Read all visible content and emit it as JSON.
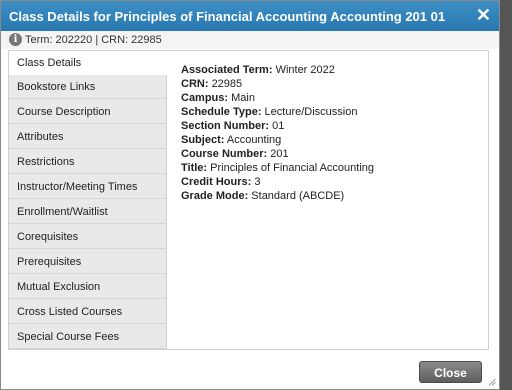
{
  "dialog": {
    "title": "Class Details for Principles of Financial Accounting Accounting 201 01",
    "close_icon": "✕"
  },
  "termbar": {
    "info_icon": "i",
    "text": "Term: 202220 | CRN: 22985"
  },
  "sidebar": {
    "items": [
      {
        "label": "Class Details",
        "active": true
      },
      {
        "label": "Bookstore Links"
      },
      {
        "label": "Course Description"
      },
      {
        "label": "Attributes"
      },
      {
        "label": "Restrictions"
      },
      {
        "label": "Instructor/Meeting Times"
      },
      {
        "label": "Enrollment/Waitlist"
      },
      {
        "label": "Corequisites"
      },
      {
        "label": "Prerequisites"
      },
      {
        "label": "Mutual Exclusion"
      },
      {
        "label": "Cross Listed Courses"
      },
      {
        "label": "Special Course Fees"
      }
    ]
  },
  "details": [
    {
      "label": "Associated Term:",
      "value": "Winter 2022"
    },
    {
      "label": "CRN:",
      "value": "22985"
    },
    {
      "label": "Campus:",
      "value": "Main"
    },
    {
      "label": "Schedule Type:",
      "value": "Lecture/Discussion"
    },
    {
      "label": "Section Number:",
      "value": "01"
    },
    {
      "label": "Subject:",
      "value": "Accounting"
    },
    {
      "label": "Course Number:",
      "value": "201"
    },
    {
      "label": "Title:",
      "value": "Principles of Financial Accounting"
    },
    {
      "label": "Credit Hours:",
      "value": "3"
    },
    {
      "label": "Grade Mode:",
      "value": "Standard (ABCDE)"
    }
  ],
  "footer": {
    "close_label": "Close"
  }
}
